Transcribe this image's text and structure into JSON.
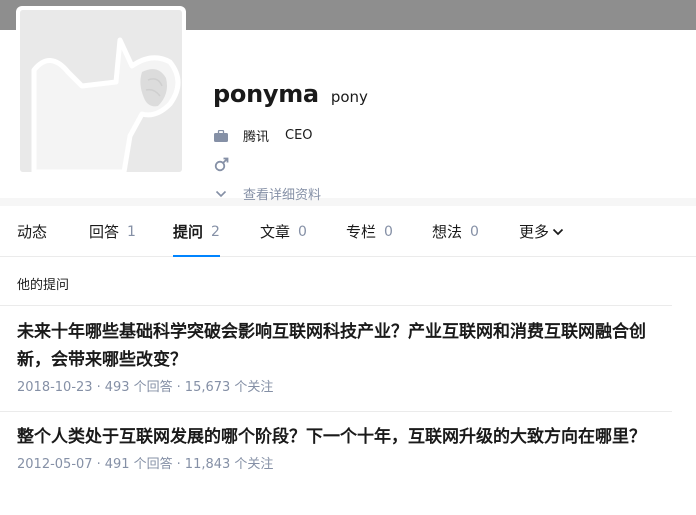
{
  "profile": {
    "name": "ponyma",
    "headline": "pony",
    "company": "腾讯",
    "position": "CEO",
    "gender_symbol": "♂",
    "details_link": "查看详细资料",
    "icons": {
      "company": "briefcase-icon",
      "gender": "male-icon",
      "details": "chevron-down-icon"
    }
  },
  "tabs": [
    {
      "label": "动态",
      "count": ""
    },
    {
      "label": "回答",
      "count": "1"
    },
    {
      "label": "提问",
      "count": "2"
    },
    {
      "label": "文章",
      "count": "0"
    },
    {
      "label": "专栏",
      "count": "0"
    },
    {
      "label": "想法",
      "count": "0"
    },
    {
      "label": "更多",
      "count": ""
    }
  ],
  "active_tab": "提问",
  "colors": {
    "accent": "#0084ff",
    "meta": "#8590a6",
    "topbar": "#8e8e8e"
  },
  "section": {
    "title": "他的提问"
  },
  "questions": [
    {
      "title": "未来十年哪些基础科学突破会影响互联网科技产业？产业互联网和消费互联网融合创新，会带来哪些改变？",
      "date": "2018-10-23",
      "answers": "493 个回答",
      "followers": "15,673 个关注"
    },
    {
      "title": "整个人类处于互联网发展的哪个阶段？下一个十年，互联网升级的大致方向在哪里？",
      "date": "2012-05-07",
      "answers": "491 个回答",
      "followers": "11,843 个关注"
    }
  ]
}
